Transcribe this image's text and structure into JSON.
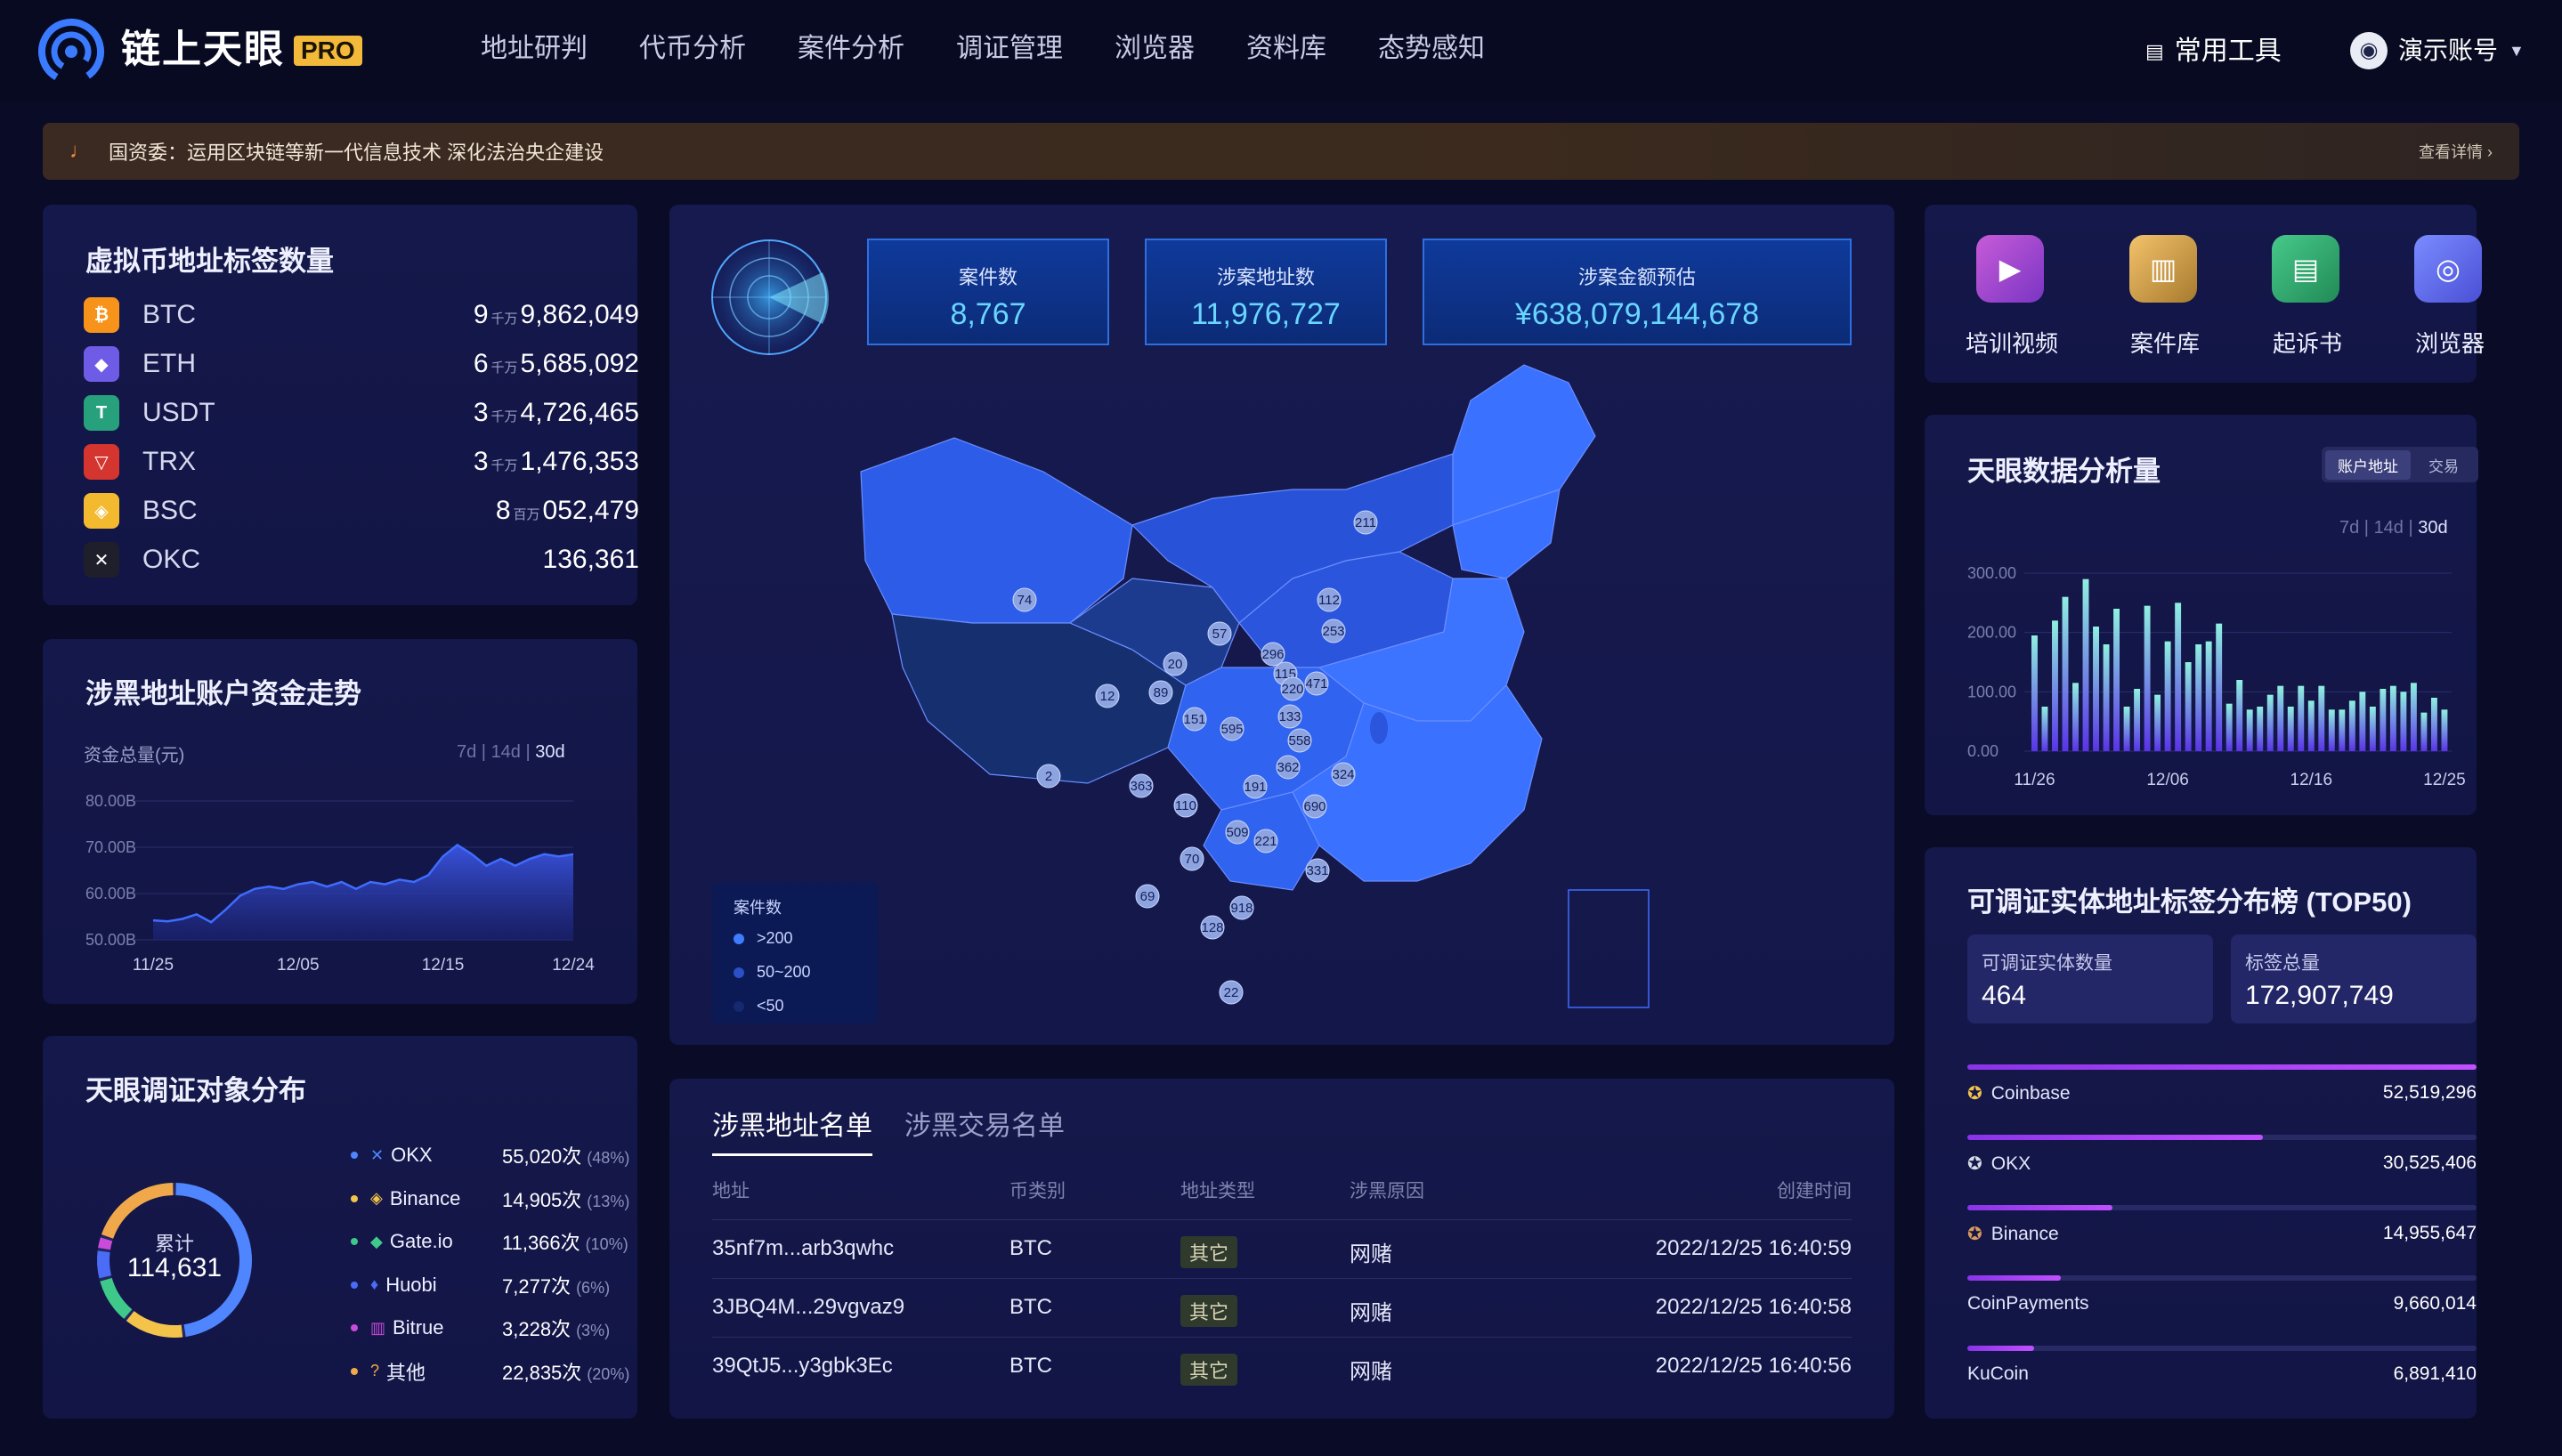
{
  "app": {
    "brand": "链上天眼",
    "badge": "PRO"
  },
  "nav": [
    "地址研判",
    "代币分析",
    "案件分析",
    "调证管理",
    "浏览器",
    "资料库",
    "态势感知"
  ],
  "header": {
    "tools_label": "常用工具",
    "account_label": "演示账号"
  },
  "notice": {
    "text": "国资委：运用区块链等新一代信息技术 深化法治央企建设",
    "more": "查看详情"
  },
  "tag_panel": {
    "title": "虚拟币地址标签数量",
    "coins": [
      {
        "name": "BTC",
        "lead": "9",
        "unit": "千万",
        "rest": "9,862,049",
        "color": "#f7931a",
        "icon": "bitcoin-icon"
      },
      {
        "name": "ETH",
        "lead": "6",
        "unit": "千万",
        "rest": "5,685,092",
        "color": "#6f5ce6",
        "icon": "ethereum-icon"
      },
      {
        "name": "USDT",
        "lead": "3",
        "unit": "千万",
        "rest": "4,726,465",
        "color": "#26a17b",
        "icon": "tether-icon"
      },
      {
        "name": "TRX",
        "lead": "3",
        "unit": "千万",
        "rest": "1,476,353",
        "color": "#d4352f",
        "icon": "tron-icon"
      },
      {
        "name": "BSC",
        "lead": "8",
        "unit": "百万",
        "rest": "052,479",
        "color": "#f3ba2f",
        "icon": "bnb-icon"
      },
      {
        "name": "OKC",
        "lead": "",
        "unit": "",
        "rest": "136,361",
        "color": "#1e1f2b",
        "icon": "okx-icon"
      }
    ]
  },
  "trend_panel": {
    "title": "涉黑地址账户资金走势",
    "ylabel": "资金总量(元)",
    "ranges": [
      "7d",
      "14d",
      "30d"
    ]
  },
  "dist_panel": {
    "title": "天眼调证对象分布",
    "center_label": "累计",
    "center_value": "114,631",
    "items": [
      {
        "name": "OKX",
        "count": "55,020次",
        "pct": "(48%)",
        "color": "#4f86ff",
        "icon": "okx-icon"
      },
      {
        "name": "Binance",
        "count": "14,905次",
        "pct": "(13%)",
        "color": "#f3c34a",
        "icon": "binance-icon"
      },
      {
        "name": "Gate.io",
        "count": "11,366次",
        "pct": "(10%)",
        "color": "#3ec98b",
        "icon": "gateio-icon"
      },
      {
        "name": "Huobi",
        "count": "7,277次",
        "pct": "(6%)",
        "color": "#4a6cf7",
        "icon": "huobi-icon"
      },
      {
        "name": "Bitrue",
        "count": "3,228次",
        "pct": "(3%)",
        "color": "#c94bd9",
        "icon": "bitrue-icon"
      },
      {
        "name": "其他",
        "count": "22,835次",
        "pct": "(20%)",
        "color": "#f0a84a",
        "icon": "other-icon"
      }
    ],
    "colors": {
      "accent": "#4f86ff"
    }
  },
  "stats": [
    {
      "label": "案件数",
      "value": "8,767"
    },
    {
      "label": "涉案地址数",
      "value": "11,976,727"
    },
    {
      "label": "涉案金额预估",
      "value": "¥638,079,144,678"
    }
  ],
  "map": {
    "legend_title": "案件数",
    "legend": [
      {
        "label": ">200",
        "color": "#3f7cff"
      },
      {
        "label": "50~200",
        "color": "#2a4fc6"
      },
      {
        "label": "<50",
        "color": "#15296e"
      }
    ],
    "bubbles": [
      "74",
      "12",
      "2",
      "89",
      "20",
      "57",
      "296",
      "115",
      "220",
      "133",
      "471",
      "253",
      "112",
      "211",
      "151",
      "595",
      "558",
      "362",
      "324",
      "690",
      "191",
      "363",
      "110",
      "509",
      "221",
      "70",
      "331",
      "69",
      "918",
      "128",
      "22"
    ]
  },
  "quick": [
    {
      "label": "培训视频",
      "icon": "video-icon"
    },
    {
      "label": "案件库",
      "icon": "case-library-icon"
    },
    {
      "label": "起诉书",
      "icon": "indictment-icon"
    },
    {
      "label": "浏览器",
      "icon": "compass-icon"
    }
  ],
  "analysis_panel": {
    "title": "天眼数据分析量",
    "toggle": [
      "账户地址",
      "交易"
    ],
    "ranges": [
      "7d",
      "14d",
      "30d"
    ]
  },
  "rank_panel": {
    "title": "可调证实体地址标签分布榜 (TOP50)",
    "cards": [
      {
        "label": "可调证实体数量",
        "value": "464"
      },
      {
        "label": "标签总量",
        "value": "172,907,749"
      }
    ],
    "rows": [
      {
        "name": "Coinbase",
        "value": "52,519,296",
        "frac": 1.0,
        "medal": "gold"
      },
      {
        "name": "OKX",
        "value": "30,525,406",
        "frac": 0.58,
        "medal": "silver"
      },
      {
        "name": "Binance",
        "value": "14,955,647",
        "frac": 0.285,
        "medal": "bronze"
      },
      {
        "name": "CoinPayments",
        "value": "9,660,014",
        "frac": 0.184,
        "medal": ""
      },
      {
        "name": "KuCoin",
        "value": "6,891,410",
        "frac": 0.131,
        "medal": ""
      }
    ]
  },
  "list_panel": {
    "tabs": [
      "涉黑地址名单",
      "涉黑交易名单"
    ],
    "columns": [
      "地址",
      "币类别",
      "地址类型",
      "涉黑原因",
      "创建时间"
    ],
    "rows": [
      {
        "addr": "35nf7m...arb3qwhc",
        "coin": "BTC",
        "type": "其它",
        "reason": "网赌",
        "time": "2022/12/25 16:40:59"
      },
      {
        "addr": "3JBQ4M...29vgvaz9",
        "coin": "BTC",
        "type": "其它",
        "reason": "网赌",
        "time": "2022/12/25 16:40:58"
      },
      {
        "addr": "39QtJ5...y3gbk3Ec",
        "coin": "BTC",
        "type": "其它",
        "reason": "网赌",
        "time": "2022/12/25 16:40:56"
      }
    ]
  },
  "chart_data": [
    {
      "type": "area",
      "title": "涉黑地址账户资金走势",
      "ylabel": "资金总量(元)",
      "yticks": [
        "80.00B",
        "70.00B",
        "60.00B",
        "50.00B"
      ],
      "ylim": [
        50,
        80
      ],
      "xticks": [
        "11/25",
        "12/05",
        "12/15",
        "12/24"
      ],
      "x": [
        "11/25",
        "11/26",
        "11/27",
        "11/28",
        "11/29",
        "11/30",
        "12/01",
        "12/02",
        "12/03",
        "12/04",
        "12/05",
        "12/06",
        "12/07",
        "12/08",
        "12/09",
        "12/10",
        "12/11",
        "12/12",
        "12/13",
        "12/14",
        "12/15",
        "12/16",
        "12/17",
        "12/18",
        "12/19",
        "12/20",
        "12/21",
        "12/22",
        "12/23",
        "12/24"
      ],
      "values": [
        54.2,
        54.0,
        54.5,
        55.5,
        53.8,
        56.5,
        59.5,
        61.0,
        61.5,
        61.0,
        62.0,
        62.5,
        61.5,
        62.5,
        61.0,
        62.5,
        62.0,
        63.0,
        62.5,
        64.0,
        68.0,
        70.5,
        68.5,
        66.0,
        67.5,
        66.0,
        67.5,
        68.5,
        68.0,
        68.5
      ],
      "grid": true,
      "colors": {
        "line": "#3f6cff",
        "fill": "#2a3fb6"
      }
    },
    {
      "type": "bar",
      "title": "天眼数据分析量",
      "yticks": [
        "300.00",
        "200.00",
        "100.00",
        "0.00"
      ],
      "ylim": [
        0,
        300
      ],
      "xticks": [
        "11/26",
        "12/06",
        "12/16",
        "12/25"
      ],
      "values": [
        195,
        75,
        220,
        260,
        115,
        290,
        210,
        180,
        240,
        75,
        105,
        245,
        95,
        185,
        250,
        150,
        180,
        185,
        215,
        80,
        120,
        70,
        75,
        95,
        110,
        75,
        110,
        85,
        110,
        70,
        70,
        85,
        100,
        75,
        105,
        110,
        100,
        115,
        65,
        90,
        70
      ],
      "grid": true,
      "colors": {
        "top": "#8ff0e0",
        "bottom": "#5a33e8"
      }
    },
    {
      "type": "pie",
      "title": "天眼调证对象分布",
      "categories": [
        "OKX",
        "Binance",
        "Gate.io",
        "Huobi",
        "Bitrue",
        "其他"
      ],
      "values": [
        55020,
        14905,
        11366,
        7277,
        3228,
        22835
      ],
      "colors": [
        "#4f86ff",
        "#f3c34a",
        "#3ec98b",
        "#4a6cf7",
        "#c94bd9",
        "#f0a84a"
      ]
    }
  ]
}
